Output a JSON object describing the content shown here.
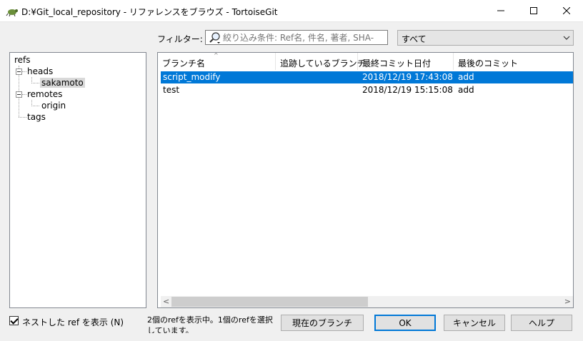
{
  "window": {
    "title": "D:¥Git_local_repository - リファレンスをブラウズ - TortoiseGit",
    "icon": "tortoisegit-icon"
  },
  "filter": {
    "label": "フィルター:",
    "placeholder": "絞り込み条件: Ref名, 件名, 著者, SHA-",
    "scope_selected": "すべて"
  },
  "tree": {
    "root": "refs",
    "heads": "heads",
    "heads_child": "sakamoto",
    "remotes": "remotes",
    "remotes_child": "origin",
    "tags": "tags"
  },
  "list": {
    "columns": [
      "ブランチ名",
      "追跡しているブランチ",
      "最終コミット日付",
      "最後のコミット"
    ],
    "rows": [
      {
        "branch": "script_modify",
        "tracking": "",
        "date": "2018/12/19 17:43:08",
        "message": "add",
        "selected": true
      },
      {
        "branch": "test",
        "tracking": "",
        "date": "2018/12/19 15:15:08",
        "message": "add",
        "selected": false
      }
    ]
  },
  "bottom": {
    "nested_checkbox_label": "ネストした ref を表示 (N)",
    "nested_checked": true,
    "status_text": "2個のrefを表示中。1個のrefを選択しています。",
    "current_branch_button": "現在のブランチ",
    "ok_button": "OK",
    "cancel_button": "キャンセル",
    "help_button": "ヘルプ"
  },
  "colors": {
    "selection": "#0078d7",
    "accent_border": "#0078d7"
  }
}
